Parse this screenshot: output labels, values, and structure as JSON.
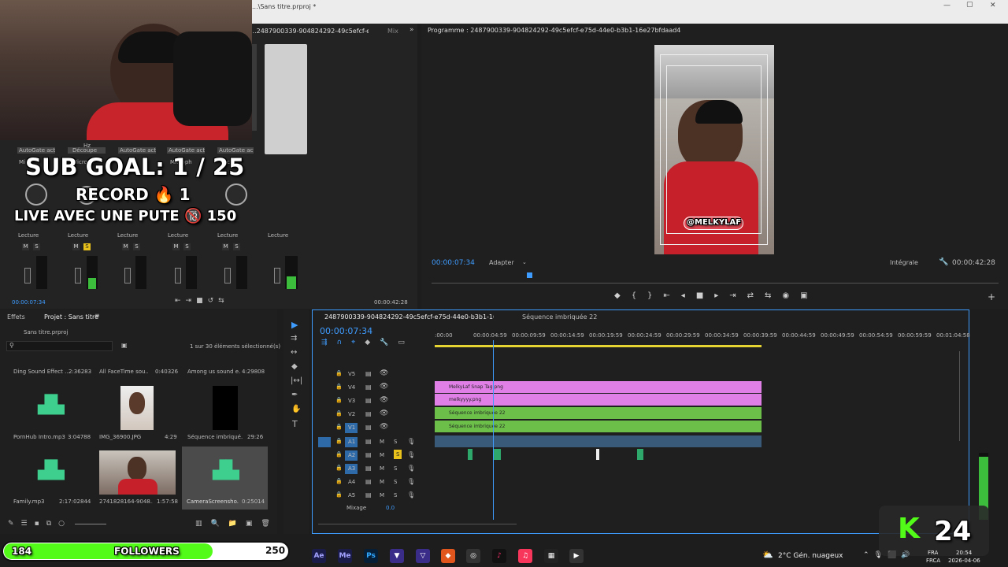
{
  "window": {
    "title": "...\\Sans titre.prproj *",
    "min": "—",
    "max": "▢",
    "close": "✕"
  },
  "source_panel": {
    "tab": "...2487900339-904824292-49c5efcf-e75d-44e0-b3b1-16e27bfdaad4",
    "tab2": "Mix",
    "more": "»"
  },
  "mixer": {
    "autogate": [
      "AutoGate activé",
      "AutoGate activé",
      "AutoGate activé",
      "AutoGate activé",
      "AutoGate activé"
    ],
    "hz": "Hz",
    "decoupe": "Découpe",
    "mic_labels": [
      "Mi",
      "Microph",
      "Microph",
      "Microph",
      "Micro",
      "Mi"
    ],
    "reads": [
      "Lecture",
      "Lecture",
      "Lecture",
      "Lecture",
      "Lecture",
      "Lecture"
    ],
    "m": "M",
    "s": "S",
    "db": "dB",
    "time_left": "00:00:07:34",
    "time_right": "00:00:42:28"
  },
  "overlay": {
    "sub_goal": "SUB GOAL: 1 / 25",
    "record": "RECORD 🔥 1",
    "live": "LIVE AVEC UNE PUTE 🔞 150",
    "follow_count": "184",
    "follow_label": "FOLLOWERS",
    "follow_goal": "250",
    "k_logo": "K",
    "k_count": "24"
  },
  "program": {
    "title": "Programme : 2487900339-904824292-49c5efcf-e75d-44e0-b3b1-16e27bfdaad4",
    "timecode": "00:00:07:34",
    "fit": "Adapter",
    "quality": "Intégrale",
    "duration": "00:00:42:28",
    "sticker": "@MELKYLAF"
  },
  "project": {
    "tab_effects": "Effets",
    "tab_project": "Projet : Sans titre",
    "file": "Sans titre.prproj",
    "selected": "1 sur 30 éléments sélectionné(s)",
    "items": [
      {
        "name": "Ding Sound Effect ...",
        "dur": "2:36283"
      },
      {
        "name": "All FaceTime sou...",
        "dur": "0:40326"
      },
      {
        "name": "Among us sound e...",
        "dur": "4:29808"
      },
      {
        "name": "PornHub Intro.mp3",
        "dur": "3:04788"
      },
      {
        "name": "IMG_36900.JPG",
        "dur": "4:29"
      },
      {
        "name": "Séquence imbriqué...",
        "dur": "29:26"
      },
      {
        "name": "Family.mp3",
        "dur": "2:17:02844"
      },
      {
        "name": "2741828164-9048...",
        "dur": "1:57:58"
      },
      {
        "name": "CameraScreensho...",
        "dur": "0:25014"
      }
    ]
  },
  "timeline": {
    "tab1": "2487900339-904824292-49c5efcf-e75d-44e0-b3b1-16e27bfdaad4",
    "tab2": "Séquence imbriquée 22",
    "timecode": "00:00:07:34",
    "ruler": [
      ":00:00",
      "00:00:04:59",
      "00:00:09:59",
      "00:00:14:59",
      "00:00:19:59",
      "00:00:24:59",
      "00:00:29:59",
      "00:00:34:59",
      "00:00:39:59",
      "00:00:44:59",
      "00:00:49:59",
      "00:00:54:59",
      "00:00:59:59",
      "00:01:04:58"
    ],
    "video_tracks": [
      "V5",
      "V4",
      "V3",
      "V2",
      "V1"
    ],
    "audio_tracks": [
      "A1",
      "A2",
      "A3",
      "A4",
      "A5"
    ],
    "clips": [
      "MelkyLaf Snap Tag.png",
      "melkyyyy.png",
      "Séquence imbriquée 22",
      "Séquence imbriquée 22"
    ],
    "mix_label": "Mixage",
    "mix_value": "0.0",
    "m": "M",
    "s": "S"
  },
  "taskbar": {
    "apps": [
      "Ae",
      "Me",
      "Ps"
    ],
    "weather": "2°C  Gén. nuageux",
    "lang1": "FRA",
    "lang2": "FRCA",
    "time": "20:54",
    "date": "2026-04-06"
  }
}
